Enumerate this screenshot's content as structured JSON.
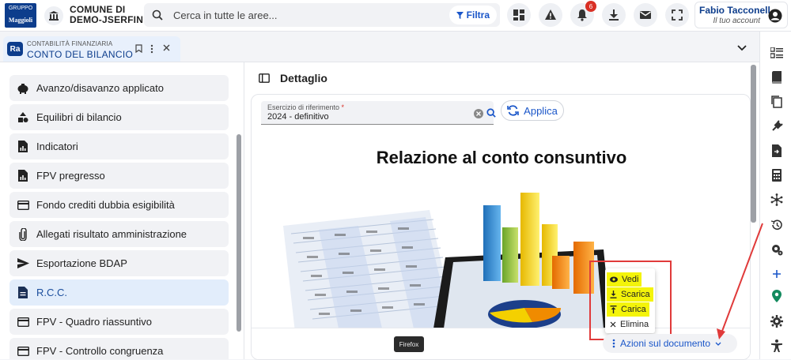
{
  "brand": {
    "logo_top": "GRUPPO",
    "logo_text": "Maggioli"
  },
  "municipality": {
    "line1": "COMUNE DI",
    "line2": "DEMO-JSERFIN"
  },
  "search": {
    "placeholder": "Cerca in tutte le aree...",
    "filter_label": "Filtra"
  },
  "notifications": {
    "count": "6"
  },
  "user": {
    "name": "Fabio Tacconell...",
    "subtitle": "Il tuo account"
  },
  "tab": {
    "category": "CONTABILITÀ FINANZIARIA",
    "title": "CONTO DEL BILANCIO",
    "badge": "Ra"
  },
  "sidebar": {
    "items": [
      {
        "label": "Avanzo/disavanzo applicato",
        "icon": "piggy-bank-icon"
      },
      {
        "label": "Equilibri di bilancio",
        "icon": "shapes-icon"
      },
      {
        "label": "Indicatori",
        "icon": "report-icon"
      },
      {
        "label": "FPV pregresso",
        "icon": "report-icon"
      },
      {
        "label": "Fondo crediti dubbia esigibilità",
        "icon": "credit-card-icon"
      },
      {
        "label": "Allegati risultato amministrazione",
        "icon": "paperclip-icon"
      },
      {
        "label": "Esportazione BDAP",
        "icon": "send-icon"
      },
      {
        "label": "R.C.C.",
        "icon": "document-icon",
        "active": true
      },
      {
        "label": "FPV - Quadro riassuntivo",
        "icon": "credit-card-icon"
      },
      {
        "label": "FPV - Controllo congruenza",
        "icon": "credit-card-icon"
      }
    ]
  },
  "detail": {
    "title": "Dettaglio",
    "field_label": "Esercizio di riferimento",
    "field_required": "*",
    "field_value": "2024 - definitivo",
    "apply_label": "Applica",
    "document_title": "Relazione al conto consuntivo",
    "actions_label": "Azioni sul documento",
    "menu": [
      {
        "label": "Vedi",
        "icon": "eye-icon",
        "highlight": true
      },
      {
        "label": "Scarica",
        "icon": "download-icon",
        "highlight": true
      },
      {
        "label": "Carica",
        "icon": "upload-icon",
        "highlight": true
      },
      {
        "label": "Elimina",
        "icon": "close-icon",
        "highlight": false
      }
    ]
  },
  "tooltip": {
    "label": "Firefox"
  },
  "colors": {
    "brand": "#0d3d8c",
    "accent": "#1a56c9",
    "annotation": "#e03a3a",
    "highlight": "#f4f40a"
  }
}
